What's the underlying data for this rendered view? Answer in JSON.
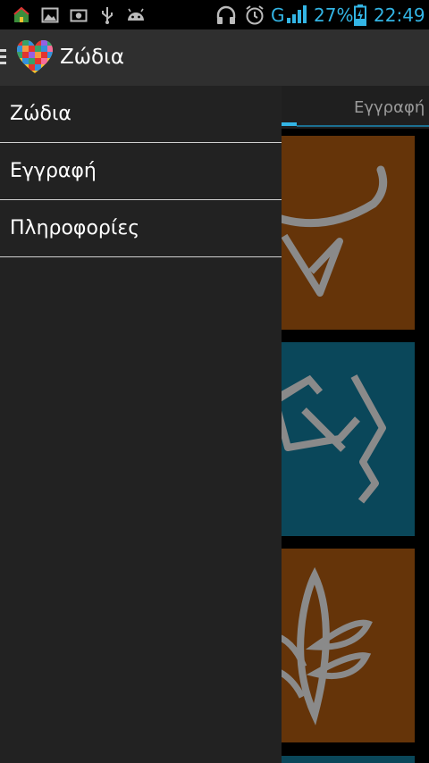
{
  "status_bar": {
    "battery_percent": "27%",
    "network_type": "G",
    "time": "22:49",
    "accent_color": "#33b5e5",
    "notification_icons": [
      "home-app-icon",
      "gallery-icon",
      "screenshot-icon",
      "usb-icon",
      "android-debug-icon"
    ],
    "system_icons": [
      "headphones-icon",
      "alarm-icon",
      "signal-icon",
      "battery-charging-icon"
    ]
  },
  "action_bar": {
    "title": "Ζώδια",
    "menu_icon": "drawer-menu-icon",
    "logo_icon": "heart-mosaic-logo"
  },
  "tabs": {
    "partial_label": "Εγγραφή"
  },
  "drawer": {
    "items": [
      {
        "label": "Ζώδια"
      },
      {
        "label": "Εγγραφή"
      },
      {
        "label": "Πληροφορίες"
      }
    ]
  },
  "tiles": [
    {
      "color": "#653409",
      "icon": "taurus-icon"
    },
    {
      "color": "#0a475a",
      "icon": "cancer-icon"
    },
    {
      "color": "#653409",
      "icon": "virgo-icon"
    }
  ]
}
